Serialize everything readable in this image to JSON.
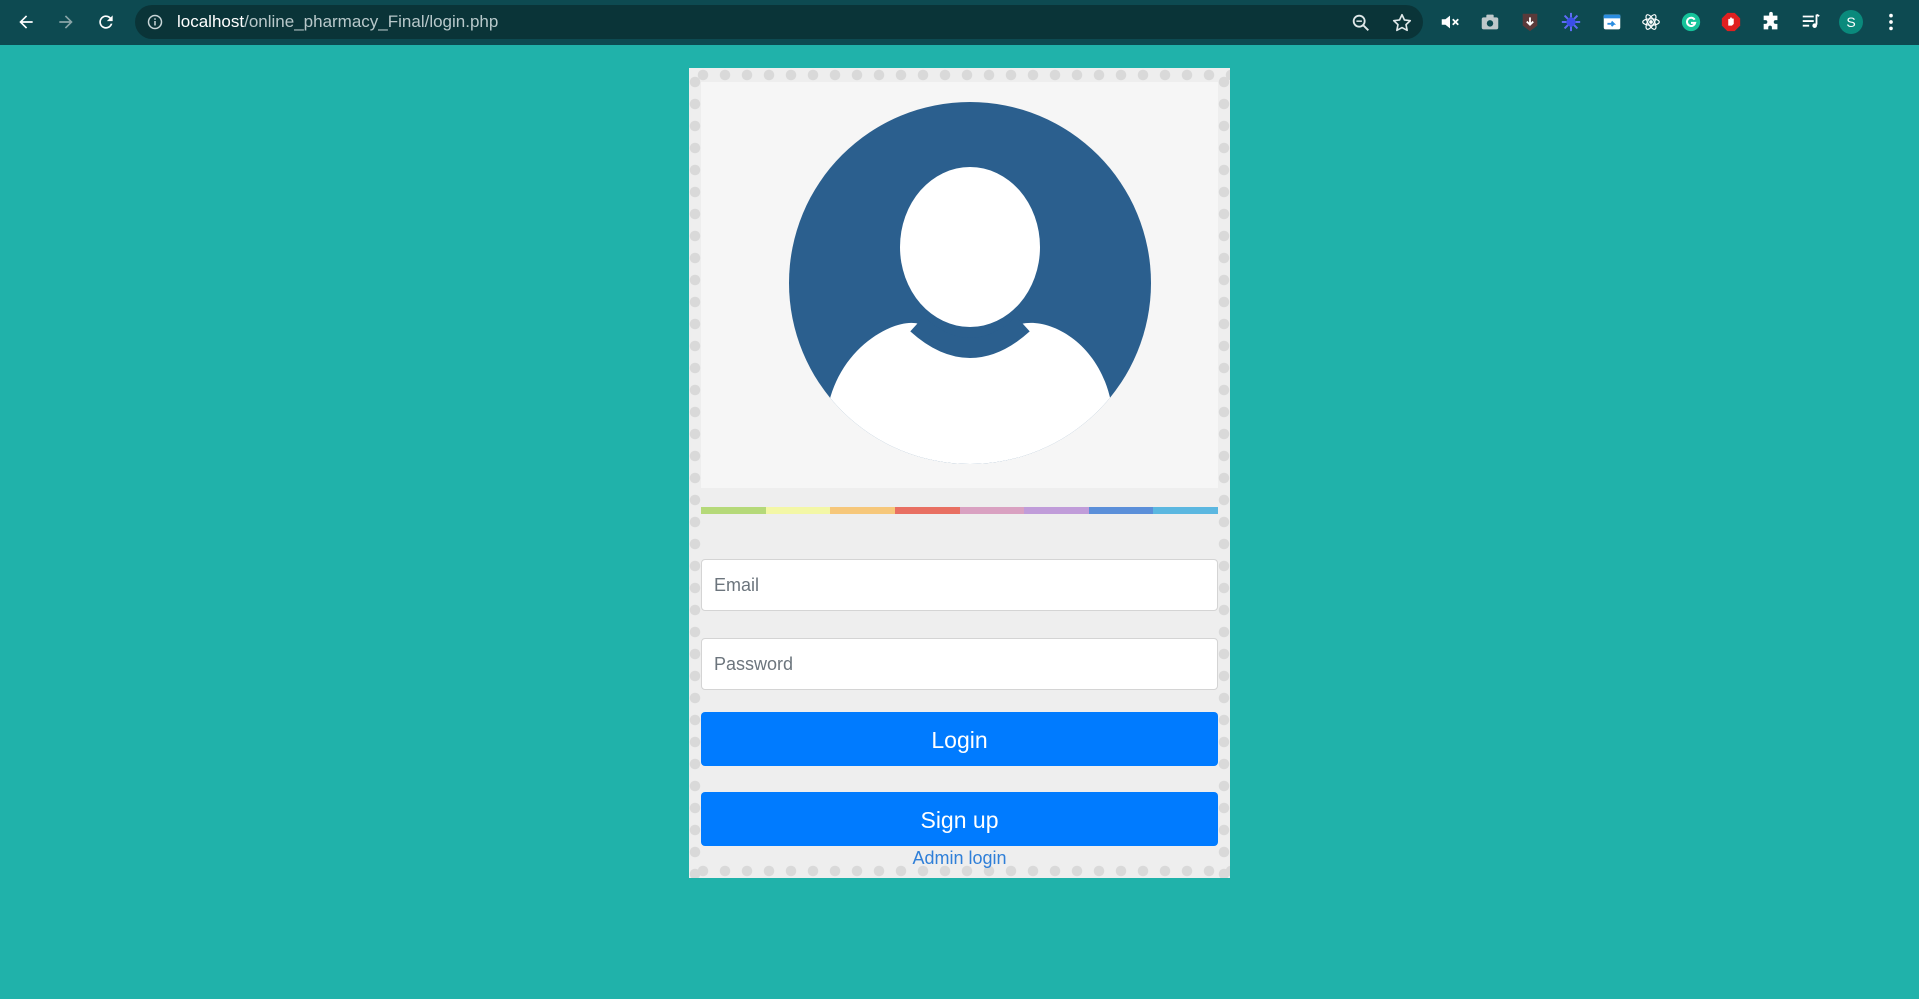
{
  "browser": {
    "url_host": "localhost",
    "url_path": "/online_pharmacy_Final/login.php",
    "profile_initial": "S"
  },
  "login_form": {
    "email_placeholder": "Email",
    "password_placeholder": "Password",
    "login_label": "Login",
    "signup_label": "Sign up",
    "admin_link_label": "Admin login"
  },
  "colors": {
    "page_background": "#20b2aa",
    "button_primary": "#007bff",
    "avatar_circle": "#2b5f8e",
    "rainbow": [
      "#b5d979",
      "#f3f7a6",
      "#f6c77a",
      "#e86f62",
      "#d9a1c1",
      "#c09cd9",
      "#5b8fd9",
      "#5bb7e0"
    ]
  },
  "icons": [
    "back-arrow-icon",
    "forward-arrow-icon",
    "reload-icon",
    "info-icon",
    "zoom-icon",
    "star-icon",
    "mute-icon",
    "camera-icon",
    "download-icon",
    "gear-extension-icon",
    "share-icon",
    "react-icon",
    "grammarly-icon",
    "adblock-icon",
    "puzzle-icon",
    "media-icon",
    "menu-icon",
    "user-avatar-icon"
  ]
}
